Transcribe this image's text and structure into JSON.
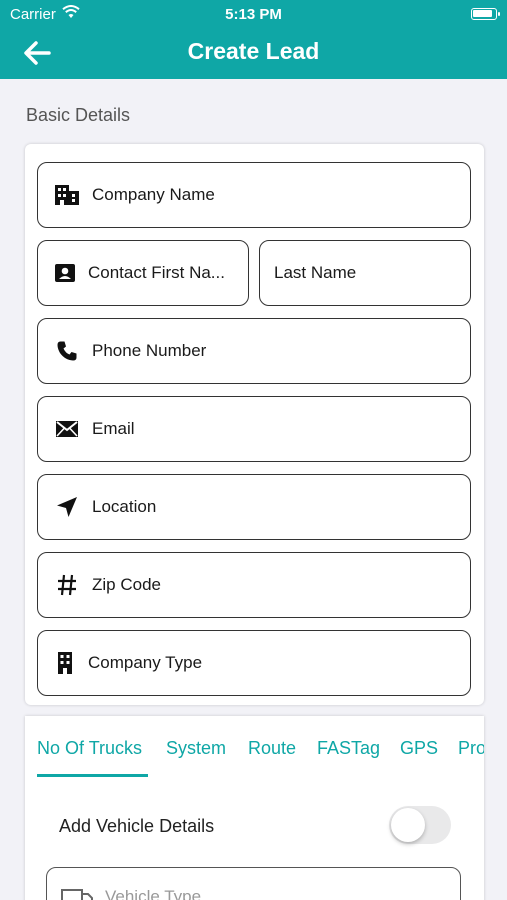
{
  "status_bar": {
    "carrier": "Carrier",
    "time": "5:13 PM"
  },
  "nav": {
    "title": "Create Lead",
    "back_icon": "arrow-left-icon"
  },
  "basic_details": {
    "section_title": "Basic Details",
    "fields": {
      "company_name": {
        "placeholder": "Company Name",
        "icon": "building-icon"
      },
      "contact_first_name": {
        "placeholder": "Contact First Na...",
        "icon": "contact-card-icon"
      },
      "last_name": {
        "placeholder": "Last Name"
      },
      "phone_number": {
        "placeholder": "Phone Number",
        "icon": "phone-icon"
      },
      "email": {
        "placeholder": "Email",
        "icon": "envelope-icon"
      },
      "location": {
        "placeholder": "Location",
        "icon": "navigation-arrow-icon"
      },
      "zip_code": {
        "placeholder": "Zip Code",
        "icon": "hash-icon"
      },
      "company_type": {
        "placeholder": "Company Type",
        "icon": "building-icon"
      }
    }
  },
  "tabs": [
    {
      "label": "No Of Trucks",
      "active": true
    },
    {
      "label": "System"
    },
    {
      "label": "Route"
    },
    {
      "label": "FASTag"
    },
    {
      "label": "GPS"
    },
    {
      "label": "Pro"
    }
  ],
  "vehicle": {
    "add_label": "Add Vehicle Details",
    "toggle_on": false,
    "type_placeholder": "Vehicle Type"
  },
  "colors": {
    "accent": "#0fa7a6",
    "background": "#f2f2f7"
  }
}
